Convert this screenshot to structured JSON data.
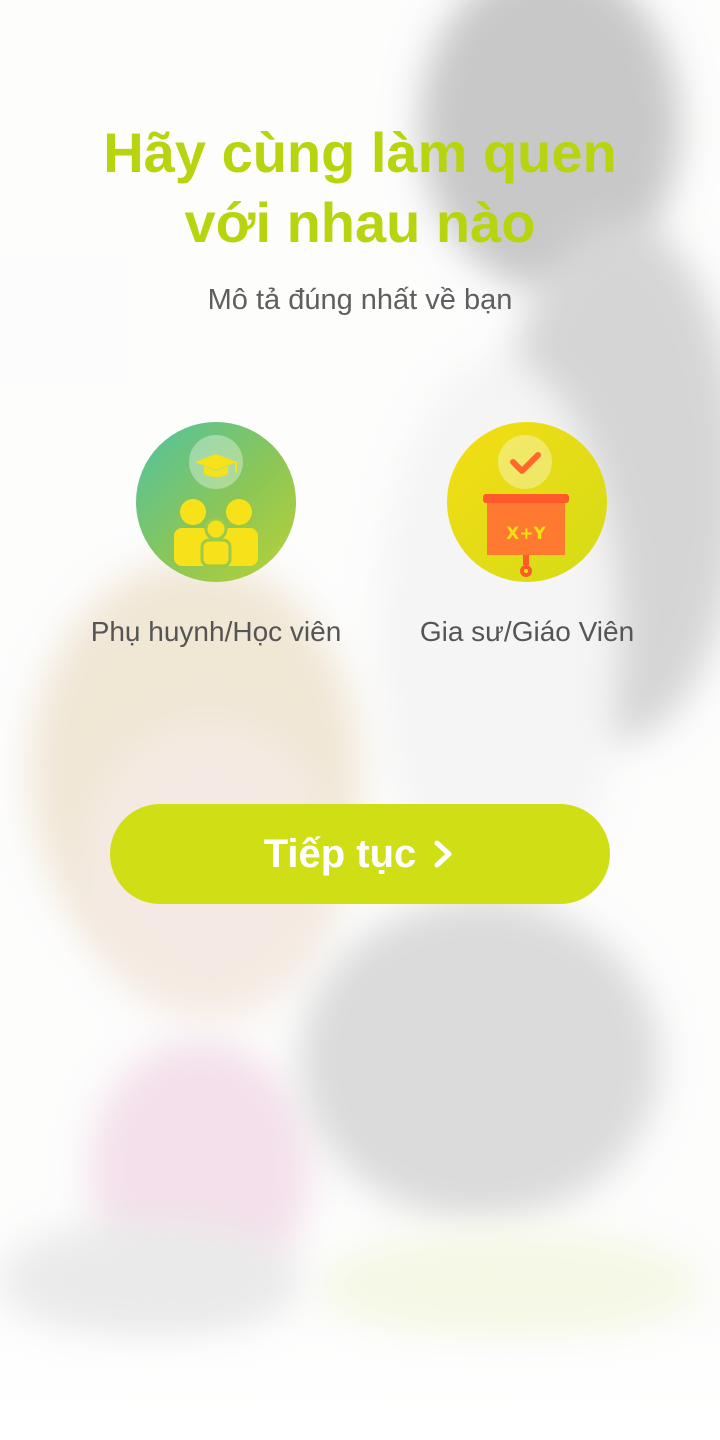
{
  "header": {
    "title_line1": "Hãy cùng làm quen",
    "title_line2": "với nhau nào",
    "subtitle": "Mô tả đúng nhất về bạn"
  },
  "roles": [
    {
      "label": "Phụ huynh/Học viên",
      "icon": "family-graduation-icon"
    },
    {
      "label": "Gia sư/Giáo Viên",
      "icon": "teaching-board-icon"
    }
  ],
  "continue_button": {
    "label": "Tiếp tục",
    "icon": "chevron-right-icon"
  },
  "colors": {
    "accent": "#b8d40e",
    "button": "#d0de16"
  }
}
